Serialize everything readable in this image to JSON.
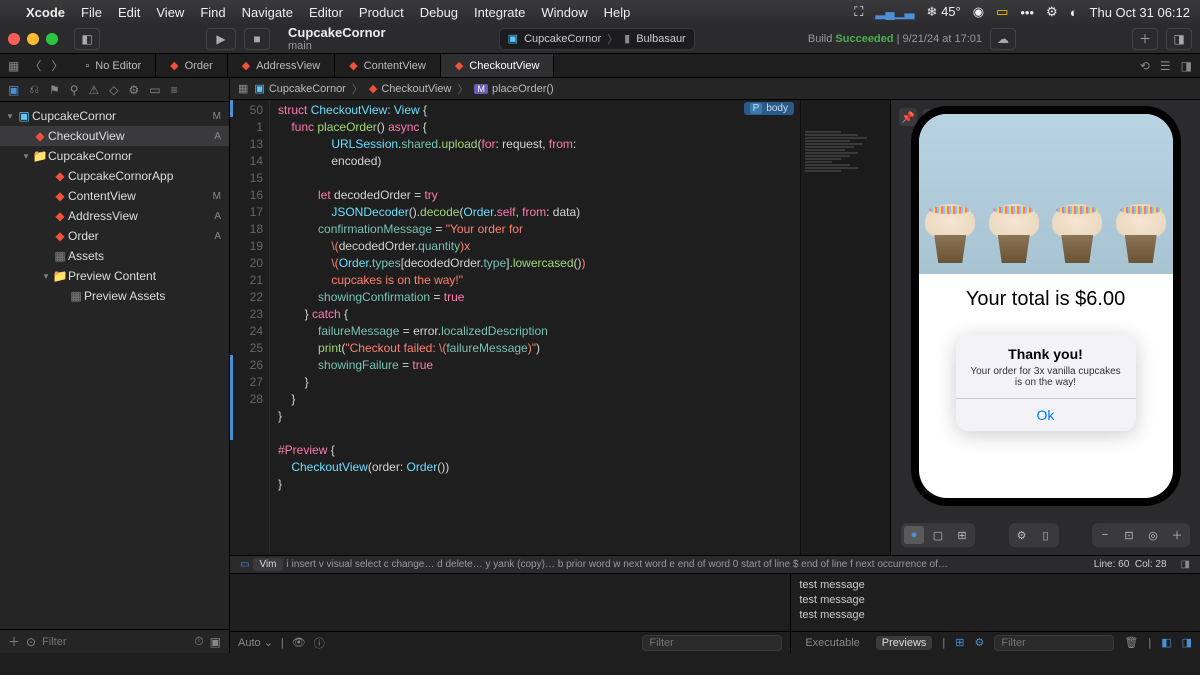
{
  "menubar": {
    "app": "Xcode",
    "items": [
      "File",
      "Edit",
      "View",
      "Find",
      "Navigate",
      "Editor",
      "Product",
      "Debug",
      "Integrate",
      "Window",
      "Help"
    ],
    "weather": "45°",
    "datetime": "Thu Oct 31  06:12"
  },
  "toolbar": {
    "project_name": "CupcakeCornor",
    "branch": "main",
    "scheme": "CupcakeCornor",
    "destination": "Bulbasaur",
    "build_label": "Build",
    "build_status": "Succeeded",
    "build_time": "9/21/24 at 17:01"
  },
  "tabs": [
    {
      "label": "No Editor",
      "icon": "no-editor",
      "active": false
    },
    {
      "label": "Order",
      "icon": "swift",
      "active": false
    },
    {
      "label": "AddressView",
      "icon": "swift",
      "active": false
    },
    {
      "label": "ContentView",
      "icon": "swift",
      "active": false
    },
    {
      "label": "CheckoutView",
      "icon": "swift",
      "active": true
    }
  ],
  "navigator": {
    "filter_placeholder": "Filter",
    "tree": [
      {
        "depth": 0,
        "icon": "app",
        "label": "CupcakeCornor",
        "status": "M",
        "disclosure": "▾"
      },
      {
        "depth": 1,
        "icon": "swift",
        "label": "CheckoutView",
        "status": "A",
        "selected": true
      },
      {
        "depth": 1,
        "icon": "folder",
        "label": "CupcakeCornor",
        "status": "",
        "disclosure": "▾"
      },
      {
        "depth": 2,
        "icon": "swift",
        "label": "CupcakeCornorApp",
        "status": ""
      },
      {
        "depth": 2,
        "icon": "swift",
        "label": "ContentView",
        "status": "M"
      },
      {
        "depth": 2,
        "icon": "swift",
        "label": "AddressView",
        "status": "A"
      },
      {
        "depth": 2,
        "icon": "swift",
        "label": "Order",
        "status": "A"
      },
      {
        "depth": 2,
        "icon": "asset",
        "label": "Assets",
        "status": ""
      },
      {
        "depth": 2,
        "icon": "folder",
        "label": "Preview Content",
        "status": "",
        "disclosure": "▾"
      },
      {
        "depth": 3,
        "icon": "asset",
        "label": "Preview Assets",
        "status": ""
      }
    ]
  },
  "jumpbar": {
    "crumbs": [
      {
        "icon": "app",
        "label": "CupcakeCornor"
      },
      {
        "icon": "swift",
        "label": "CheckoutView"
      },
      {
        "icon": "method",
        "label": "placeOrder()"
      }
    ]
  },
  "code": {
    "line_numbers": [
      "50",
      "1",
      "",
      "13",
      "14",
      "",
      "15",
      "",
      "",
      "",
      "16",
      "17",
      "18",
      "19",
      "20",
      "21",
      "22",
      "23",
      "24",
      "25",
      "26",
      "27",
      "28"
    ],
    "param_badge": "body"
  },
  "vim": {
    "mode": "Vim",
    "hints": "i insert  v visual select  c change…  d delete…  y yank (copy)…  b prior word  w next word  e end of word  0 start of line  $ end of line  f next occurrence of…",
    "line": "60",
    "col": "28"
  },
  "preview": {
    "title": "CheckoutView",
    "total_text": "Your total is $6.00",
    "alert_title": "Thank you!",
    "alert_message": "Your order for 3x vanilla cupcakes is on the way!",
    "alert_ok": "Ok"
  },
  "debug": {
    "auto_label": "Auto",
    "filter_placeholder": "Filter",
    "executable_label": "Executable",
    "previews_label": "Previews",
    "console_lines": [
      "test message",
      "test message",
      "test message"
    ]
  }
}
